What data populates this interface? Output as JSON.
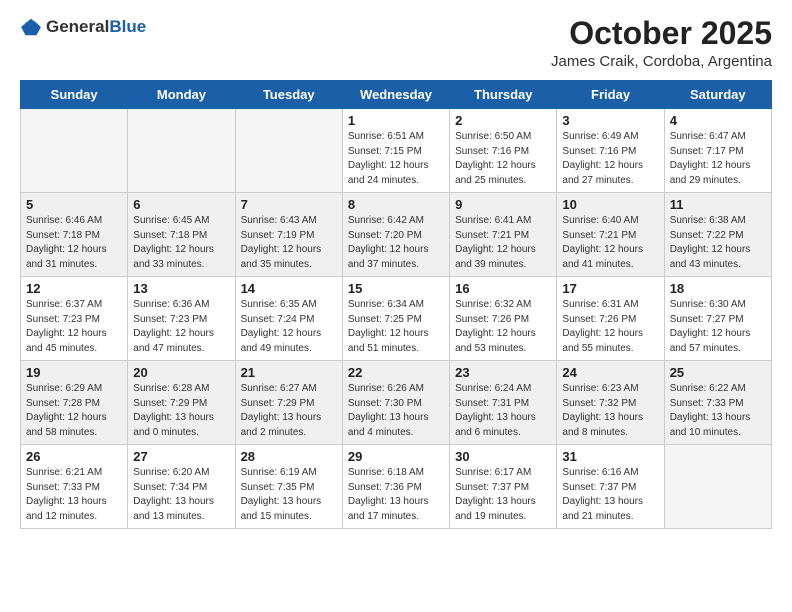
{
  "header": {
    "logo_general": "General",
    "logo_blue": "Blue",
    "month_title": "October 2025",
    "location": "James Craik, Cordoba, Argentina"
  },
  "weekdays": [
    "Sunday",
    "Monday",
    "Tuesday",
    "Wednesday",
    "Thursday",
    "Friday",
    "Saturday"
  ],
  "rows": [
    [
      {
        "day": "",
        "info": ""
      },
      {
        "day": "",
        "info": ""
      },
      {
        "day": "",
        "info": ""
      },
      {
        "day": "1",
        "info": "Sunrise: 6:51 AM\nSunset: 7:15 PM\nDaylight: 12 hours\nand 24 minutes."
      },
      {
        "day": "2",
        "info": "Sunrise: 6:50 AM\nSunset: 7:16 PM\nDaylight: 12 hours\nand 25 minutes."
      },
      {
        "day": "3",
        "info": "Sunrise: 6:49 AM\nSunset: 7:16 PM\nDaylight: 12 hours\nand 27 minutes."
      },
      {
        "day": "4",
        "info": "Sunrise: 6:47 AM\nSunset: 7:17 PM\nDaylight: 12 hours\nand 29 minutes."
      }
    ],
    [
      {
        "day": "5",
        "info": "Sunrise: 6:46 AM\nSunset: 7:18 PM\nDaylight: 12 hours\nand 31 minutes."
      },
      {
        "day": "6",
        "info": "Sunrise: 6:45 AM\nSunset: 7:18 PM\nDaylight: 12 hours\nand 33 minutes."
      },
      {
        "day": "7",
        "info": "Sunrise: 6:43 AM\nSunset: 7:19 PM\nDaylight: 12 hours\nand 35 minutes."
      },
      {
        "day": "8",
        "info": "Sunrise: 6:42 AM\nSunset: 7:20 PM\nDaylight: 12 hours\nand 37 minutes."
      },
      {
        "day": "9",
        "info": "Sunrise: 6:41 AM\nSunset: 7:21 PM\nDaylight: 12 hours\nand 39 minutes."
      },
      {
        "day": "10",
        "info": "Sunrise: 6:40 AM\nSunset: 7:21 PM\nDaylight: 12 hours\nand 41 minutes."
      },
      {
        "day": "11",
        "info": "Sunrise: 6:38 AM\nSunset: 7:22 PM\nDaylight: 12 hours\nand 43 minutes."
      }
    ],
    [
      {
        "day": "12",
        "info": "Sunrise: 6:37 AM\nSunset: 7:23 PM\nDaylight: 12 hours\nand 45 minutes."
      },
      {
        "day": "13",
        "info": "Sunrise: 6:36 AM\nSunset: 7:23 PM\nDaylight: 12 hours\nand 47 minutes."
      },
      {
        "day": "14",
        "info": "Sunrise: 6:35 AM\nSunset: 7:24 PM\nDaylight: 12 hours\nand 49 minutes."
      },
      {
        "day": "15",
        "info": "Sunrise: 6:34 AM\nSunset: 7:25 PM\nDaylight: 12 hours\nand 51 minutes."
      },
      {
        "day": "16",
        "info": "Sunrise: 6:32 AM\nSunset: 7:26 PM\nDaylight: 12 hours\nand 53 minutes."
      },
      {
        "day": "17",
        "info": "Sunrise: 6:31 AM\nSunset: 7:26 PM\nDaylight: 12 hours\nand 55 minutes."
      },
      {
        "day": "18",
        "info": "Sunrise: 6:30 AM\nSunset: 7:27 PM\nDaylight: 12 hours\nand 57 minutes."
      }
    ],
    [
      {
        "day": "19",
        "info": "Sunrise: 6:29 AM\nSunset: 7:28 PM\nDaylight: 12 hours\nand 58 minutes."
      },
      {
        "day": "20",
        "info": "Sunrise: 6:28 AM\nSunset: 7:29 PM\nDaylight: 13 hours\nand 0 minutes."
      },
      {
        "day": "21",
        "info": "Sunrise: 6:27 AM\nSunset: 7:29 PM\nDaylight: 13 hours\nand 2 minutes."
      },
      {
        "day": "22",
        "info": "Sunrise: 6:26 AM\nSunset: 7:30 PM\nDaylight: 13 hours\nand 4 minutes."
      },
      {
        "day": "23",
        "info": "Sunrise: 6:24 AM\nSunset: 7:31 PM\nDaylight: 13 hours\nand 6 minutes."
      },
      {
        "day": "24",
        "info": "Sunrise: 6:23 AM\nSunset: 7:32 PM\nDaylight: 13 hours\nand 8 minutes."
      },
      {
        "day": "25",
        "info": "Sunrise: 6:22 AM\nSunset: 7:33 PM\nDaylight: 13 hours\nand 10 minutes."
      }
    ],
    [
      {
        "day": "26",
        "info": "Sunrise: 6:21 AM\nSunset: 7:33 PM\nDaylight: 13 hours\nand 12 minutes."
      },
      {
        "day": "27",
        "info": "Sunrise: 6:20 AM\nSunset: 7:34 PM\nDaylight: 13 hours\nand 13 minutes."
      },
      {
        "day": "28",
        "info": "Sunrise: 6:19 AM\nSunset: 7:35 PM\nDaylight: 13 hours\nand 15 minutes."
      },
      {
        "day": "29",
        "info": "Sunrise: 6:18 AM\nSunset: 7:36 PM\nDaylight: 13 hours\nand 17 minutes."
      },
      {
        "day": "30",
        "info": "Sunrise: 6:17 AM\nSunset: 7:37 PM\nDaylight: 13 hours\nand 19 minutes."
      },
      {
        "day": "31",
        "info": "Sunrise: 6:16 AM\nSunset: 7:37 PM\nDaylight: 13 hours\nand 21 minutes."
      },
      {
        "day": "",
        "info": ""
      }
    ]
  ]
}
